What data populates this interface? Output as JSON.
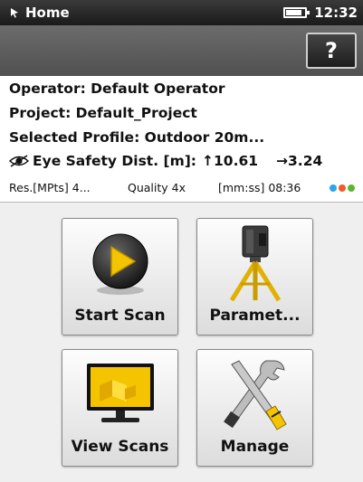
{
  "status_bar": {
    "title": "Home",
    "time": "12:32",
    "battery_level": 0.85,
    "icon": "pointer-hand-icon"
  },
  "toolbar": {
    "help_label": "?"
  },
  "info": {
    "operator": "Operator: Default Operator",
    "project": "Project: Default_Project",
    "profile": "Selected Profile: Outdoor 20m...",
    "eye_safety_label": "Eye Safety Dist. [m]:",
    "eye_safety_up": "↑10.61",
    "eye_safety_right": "→3.24",
    "resolution": "Res.[MPts] 4...",
    "quality": "Quality 4x",
    "duration": "[mm:ss] 08:36",
    "indicator_colors": [
      "#2aa7e8",
      "#f05a28",
      "#5cb531"
    ]
  },
  "tiles": {
    "start_scan": {
      "label": "Start Scan",
      "icon": "play-icon"
    },
    "parameters": {
      "label": "Paramet...",
      "icon": "scanner-tripod-icon"
    },
    "view_scans": {
      "label": "View Scans",
      "icon": "monitor-icon"
    },
    "manage": {
      "label": "Manage",
      "icon": "tools-icon"
    }
  },
  "colors": {
    "accent_yellow": "#f5c400",
    "status_bar": "#2a2a2a",
    "toolbar": "#5e5e5e"
  }
}
